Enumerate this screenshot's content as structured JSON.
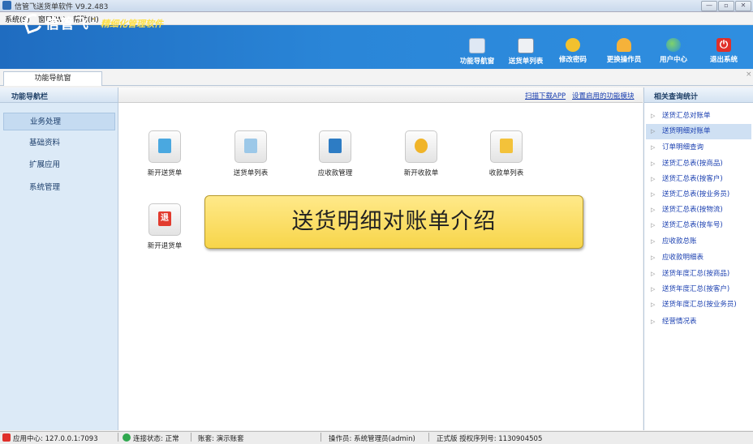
{
  "window": {
    "title": "信管飞送货单软件 V9.2.483",
    "controls": [
      "—",
      "▫",
      "✕"
    ]
  },
  "menu": [
    "系统(S)",
    "窗口(W)",
    "帮助(H)"
  ],
  "banner": {
    "logo": "信管飞",
    "slogan": "精细化管理软件"
  },
  "toolbar": [
    {
      "label": "功能导航窗",
      "icon": "monitor-icon",
      "color": "#dfe8f4"
    },
    {
      "label": "送货单列表",
      "icon": "list-icon",
      "color": "#eef1f4"
    },
    {
      "label": "修改密码",
      "icon": "lock-user-icon",
      "color": "#f2c12e"
    },
    {
      "label": "更换操作员",
      "icon": "user-icon",
      "color": "#f5b23a"
    },
    {
      "label": "用户中心",
      "icon": "globe-icon",
      "color": "#3fb34f"
    },
    {
      "label": "退出系统",
      "icon": "power-icon",
      "color": "#e0302a"
    }
  ],
  "tabs": [
    {
      "label": "功能导航窗"
    }
  ],
  "sidebar": {
    "title": "功能导航栏",
    "items": [
      {
        "label": "业务处理",
        "active": true
      },
      {
        "label": "基础资料",
        "active": false
      },
      {
        "label": "扩展应用",
        "active": false
      },
      {
        "label": "系统管理",
        "active": false
      }
    ]
  },
  "main": {
    "links": [
      "扫描下载APP",
      "设置启用的功能模块"
    ],
    "functions": [
      {
        "label": "新开送货单",
        "icon": "cart-doc-icon",
        "color": "#4aa8e0"
      },
      {
        "label": "送货单列表",
        "icon": "list-doc-icon",
        "color": "#9cc8e8"
      },
      {
        "label": "应收款管理",
        "icon": "receivable-icon",
        "color": "#2d7cc4"
      },
      {
        "label": "新开收款单",
        "icon": "coin-receipt-icon",
        "color": "#f0b429"
      },
      {
        "label": "收款单列表",
        "icon": "coin-list-icon",
        "color": "#f3c23a"
      },
      {
        "label": "新开退货单",
        "icon": "return-icon",
        "color": "#e23b2e"
      }
    ],
    "overlay_banner": "送货明细对账单介绍"
  },
  "right_panel": {
    "title": "相关查询统计",
    "items": [
      {
        "label": "送货汇总对账单",
        "active": false
      },
      {
        "label": "送货明细对账单",
        "active": true
      },
      {
        "label": "订单明细查询",
        "active": false
      },
      {
        "label": "送货汇总表(按商品)",
        "active": false
      },
      {
        "label": "送货汇总表(按客户)",
        "active": false
      },
      {
        "label": "送货汇总表(按业务员)",
        "active": false
      },
      {
        "label": "送货汇总表(按物流)",
        "active": false
      },
      {
        "label": "送货汇总表(按车号)",
        "active": false
      },
      {
        "label": "应收款总账",
        "active": false
      },
      {
        "label": "应收款明细表",
        "active": false
      },
      {
        "label": "送货年度汇总(按商品)",
        "active": false
      },
      {
        "label": "送货年度汇总(按客户)",
        "active": false
      },
      {
        "label": "送货年度汇总(按业务员)",
        "active": false
      },
      {
        "label": "经营情况表",
        "active": false
      }
    ]
  },
  "status": {
    "app_center": "应用中心: 127.0.0.1:7093",
    "connection": "连接状态: 正常",
    "account": "账套: 演示账套",
    "operator": "操作员: 系统管理员(admin)",
    "license": "正式版 授权序列号: 1130904505"
  }
}
